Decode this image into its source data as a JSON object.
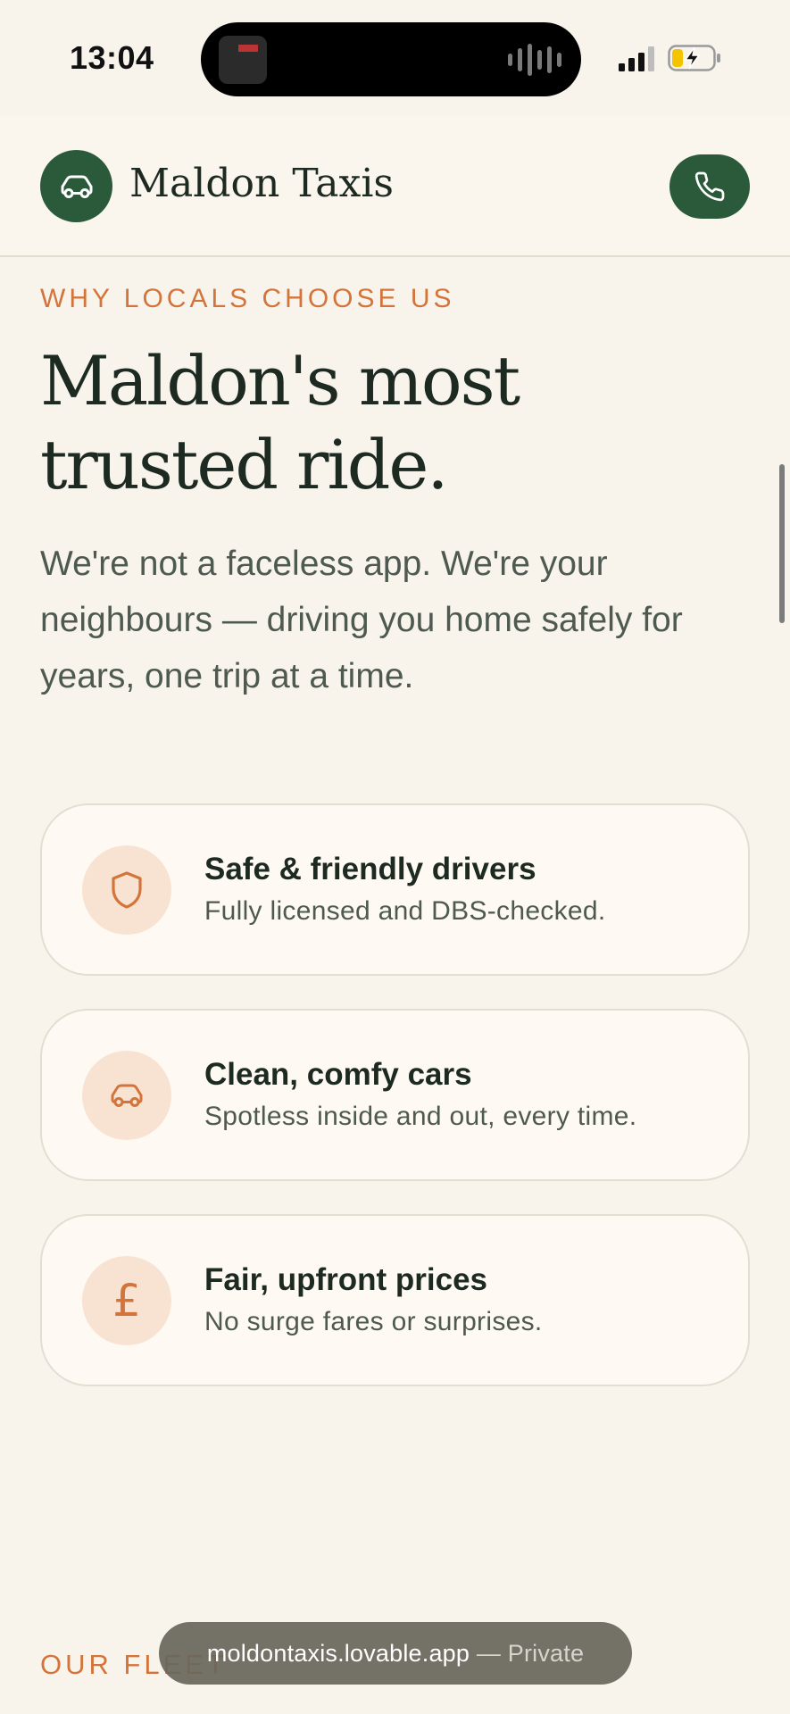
{
  "status_bar": {
    "time": "13:04"
  },
  "header": {
    "brand": "Maldon Taxis",
    "logo_icon": "car-icon",
    "call_icon": "phone-icon"
  },
  "section": {
    "eyebrow": "WHY LOCALS CHOOSE US",
    "headline": "Maldon's most trusted ride.",
    "lead": "We're not a faceless app. We're your neighbours — driving you home safely for years, one trip at a time."
  },
  "features": [
    {
      "icon": "shield-icon",
      "title": "Safe & friendly drivers",
      "text": "Fully licensed and DBS-checked."
    },
    {
      "icon": "car-icon",
      "title": "Clean, comfy cars",
      "text": "Spotless inside and out, every time."
    },
    {
      "icon": "pound-icon",
      "glyph": "£",
      "title": "Fair, upfront prices",
      "text": "No surge fares or surprises."
    }
  ],
  "next_section": {
    "eyebrow": "OUR FLEET"
  },
  "browser": {
    "url": "moldontaxis.lovable.app",
    "mode": "— Private"
  },
  "colors": {
    "brand_green": "#2b5a3b",
    "accent_orange": "#d3753a",
    "background": "#f8f4ec",
    "icon_bg": "#f8e3d2"
  }
}
